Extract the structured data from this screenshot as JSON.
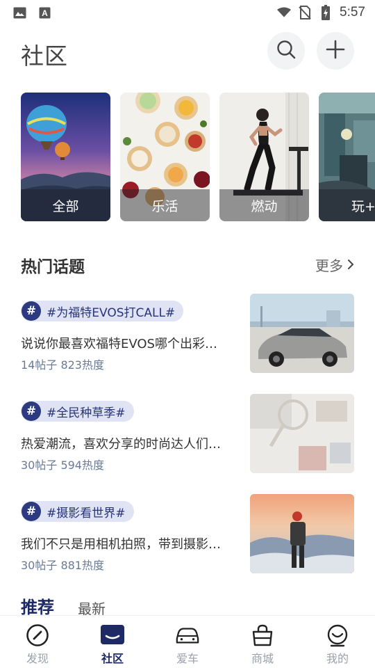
{
  "status_bar": {
    "time": "5:57"
  },
  "header": {
    "title": "社区"
  },
  "categories": [
    {
      "label": "全部"
    },
    {
      "label": "乐活"
    },
    {
      "label": "燃动"
    },
    {
      "label": "玩+"
    }
  ],
  "hot_topics": {
    "title": "热门话题",
    "more_label": "更多",
    "items": [
      {
        "tag": "#为福特EVOS打CALL#",
        "desc": "说说你最喜欢福特EVOS哪个出彩…",
        "meta": "14帖子 823热度"
      },
      {
        "tag": "#全民种草季#",
        "desc": "热爱潮流，喜欢分享的时尚达人们…",
        "meta": "30帖子 594热度"
      },
      {
        "tag": "#摄影看世界#",
        "desc": "我们不只是用相机拍照，带到摄影…",
        "meta": "30帖子 881热度"
      }
    ],
    "hash_symbol": "#"
  },
  "feed_tabs": {
    "active": "推荐",
    "other": "最新"
  },
  "bottom_nav": [
    {
      "label": "发现",
      "icon": "compass-icon"
    },
    {
      "label": "社区",
      "icon": "community-icon",
      "active": true
    },
    {
      "label": "爱车",
      "icon": "car-icon"
    },
    {
      "label": "商城",
      "icon": "shopping-bag-icon"
    },
    {
      "label": "我的",
      "icon": "smile-icon"
    }
  ],
  "colors": {
    "accent": "#1e2a66",
    "tag_bg": "#dfe3f3",
    "meta": "#6a7a95"
  }
}
